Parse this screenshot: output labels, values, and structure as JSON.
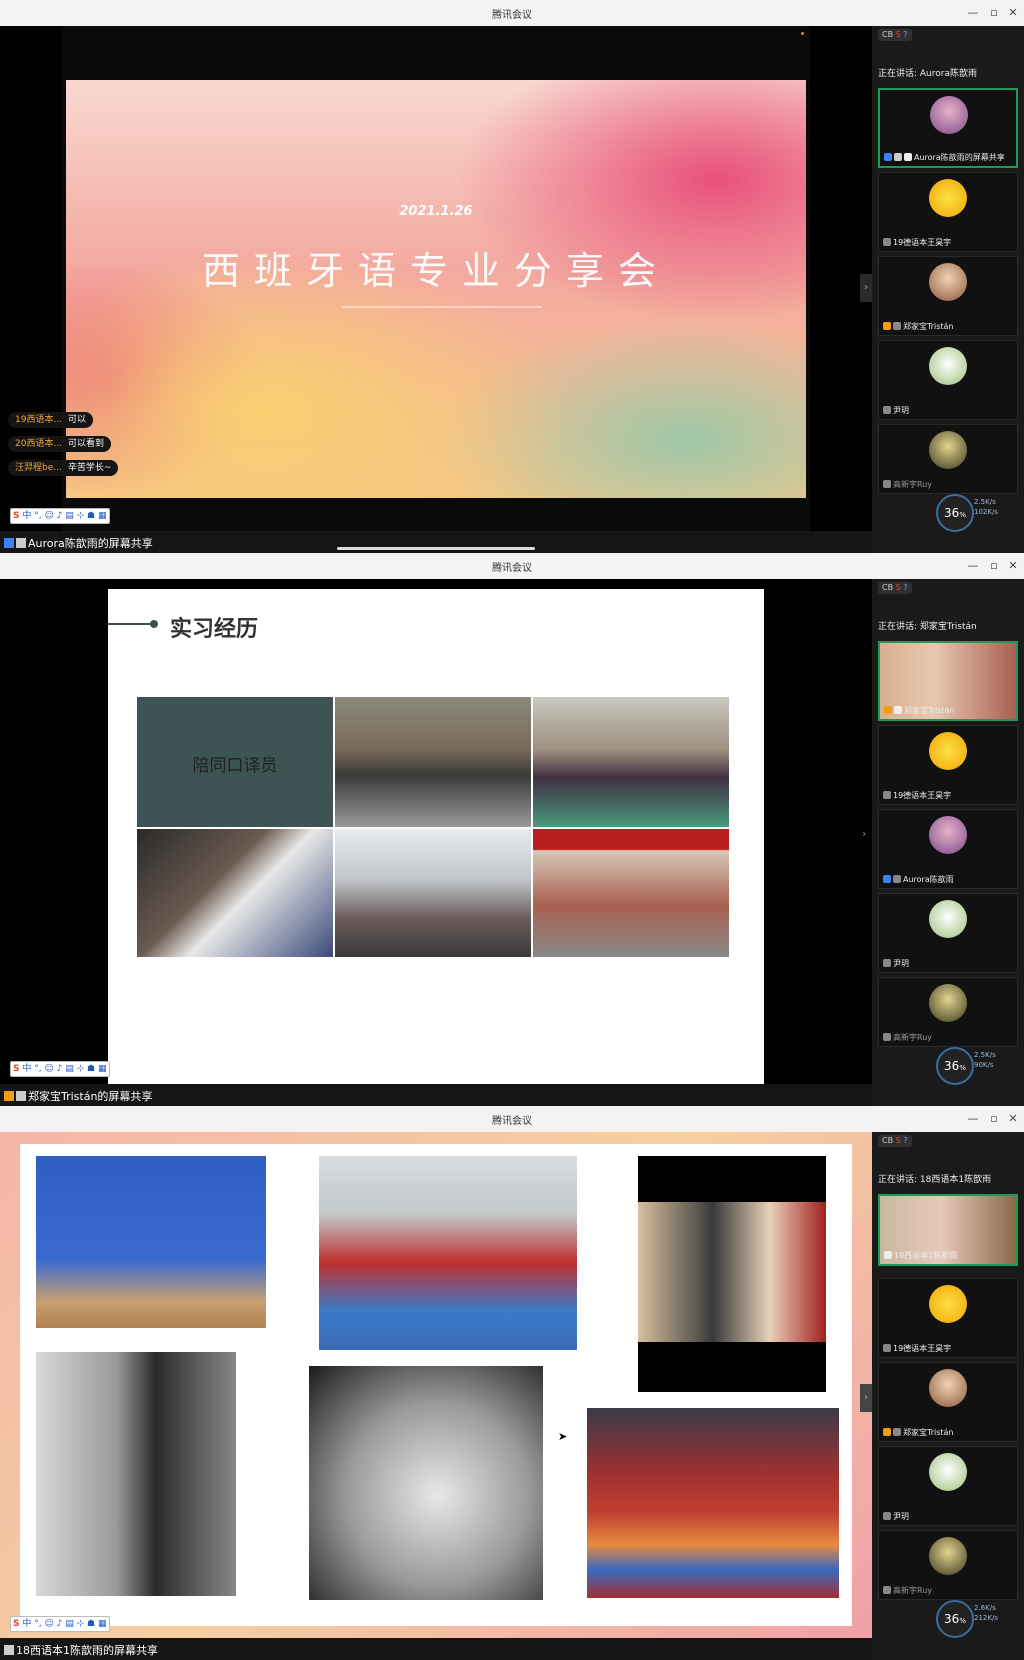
{
  "app": {
    "title": "腾讯会议"
  },
  "windows": [
    {
      "sidebar_top": "CB",
      "speaking": "正在讲话: Aurora陈歆雨",
      "slide": {
        "date": "2021.1.26",
        "title": "西班牙语专业分享会"
      },
      "chat": [
        {
          "name": "19西语本...",
          "msg": "可以"
        },
        {
          "name": "20西语本...",
          "msg": "可以看到"
        },
        {
          "name": "汪羿程be...",
          "msg": "辛苦学长~"
        }
      ],
      "share_label": "Aurora陈歆雨的屏幕共享",
      "participants": [
        "Aurora陈歆雨的屏幕共享",
        "19德语本王昊宇",
        "郑家宝Tristán",
        "尹玥",
        "高新宇Ruy"
      ],
      "speed": {
        "value": "36",
        "unit": "%",
        "up": "2.5K/s",
        "down": "102K/s"
      }
    },
    {
      "sidebar_top": "CB",
      "speaking": "正在讲话: 郑家宝Tristán",
      "slide": {
        "heading": "实习经历",
        "box_label": "陪同口译员"
      },
      "share_label": "郑家宝Tristán的屏幕共享",
      "participants": [
        "郑家宝Tristán",
        "19德语本王昊宇",
        "Aurora陈歆雨",
        "尹玥",
        "高新宇Ruy"
      ],
      "speed": {
        "value": "36",
        "unit": "%",
        "up": "2.5K/s",
        "down": "90K/s"
      }
    },
    {
      "sidebar_top": "CB",
      "speaking": "正在讲话: 18西语本1陈歆雨",
      "share_label": "18西语本1陈歆雨的屏幕共享",
      "participants": [
        "18西语本1陈歆雨",
        "19德语本王昊宇",
        "郑家宝Tristán",
        "尹玥",
        "高新宇Ruy"
      ],
      "speed": {
        "value": "36",
        "unit": "%",
        "up": "2.6K/s",
        "down": "212K/s"
      }
    }
  ],
  "ime": {
    "brand": "S",
    "chars": "中 °, ☺ ♪ ▤ ⊹ ☗ ▦"
  },
  "colors": {
    "accent_green": "#1d9a5a",
    "chat_name": "#f3a33a",
    "titlebar": "#f3f3f3"
  }
}
